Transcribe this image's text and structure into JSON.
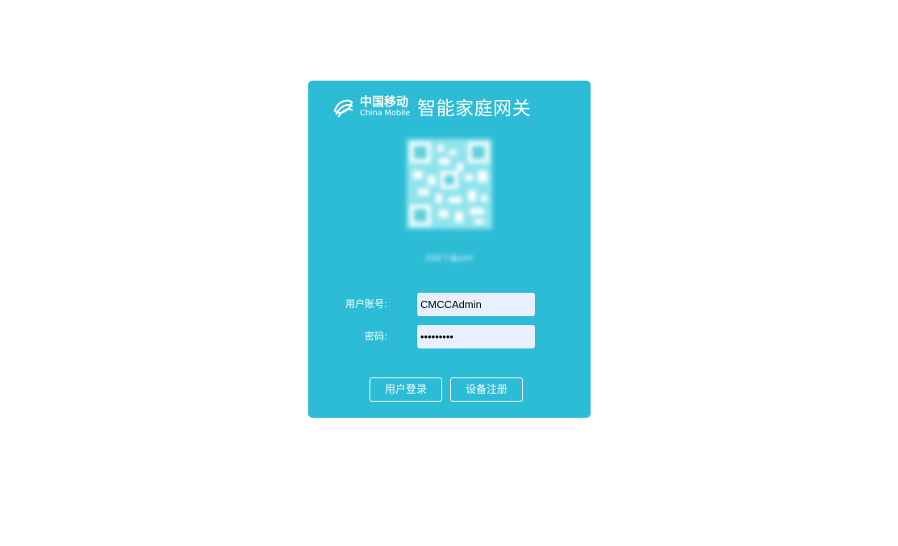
{
  "brand": {
    "company_cn": "中国移动",
    "company_en": "China Mobile",
    "product": "智能家庭网关"
  },
  "qr": {
    "caption": "扫码下载APP"
  },
  "form": {
    "username_label": "用户账号:",
    "username_value": "CMCCAdmin",
    "password_label": "密码:",
    "password_value": "123456789"
  },
  "buttons": {
    "login": "用户登录",
    "register": "设备注册"
  },
  "colors": {
    "panel": "#2dbcd6",
    "input_bg": "#e8f0fe",
    "text": "#ffffff"
  }
}
